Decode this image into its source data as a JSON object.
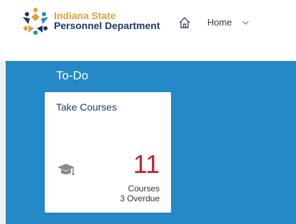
{
  "header": {
    "org_name_line1": "Indiana State",
    "org_name_line2": "Personnel Department",
    "nav_label": "Home"
  },
  "colors": {
    "brand_gold": "#e2a03a",
    "brand_navy": "#1b3766",
    "shell_blue": "#2489c6",
    "count_red": "#cc2128"
  },
  "icons": [
    "ispd-logo-icon",
    "home-icon",
    "chevron-down-icon",
    "graduation-cap-icon"
  ],
  "section": {
    "title": "To-Do",
    "tile": {
      "title": "Take Courses",
      "count": "11",
      "unit": "Courses",
      "overdue": "3 Overdue"
    }
  }
}
